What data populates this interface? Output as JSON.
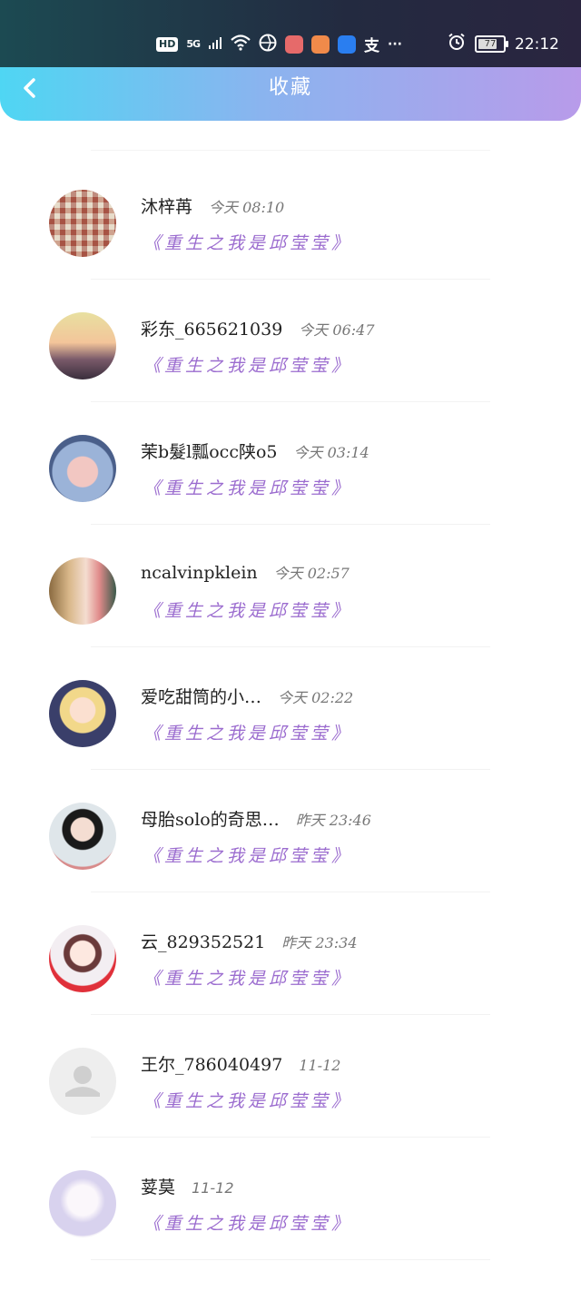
{
  "status_bar": {
    "network_hd": "HD",
    "network_type": "5G",
    "more": "···",
    "battery": "77",
    "time": "22:12",
    "app_icon_colors": [
      "#e66a6a",
      "#f08a4a",
      "#2a7ef0"
    ],
    "alipay": "支"
  },
  "header": {
    "title": "收藏",
    "back_icon": "chevron-left-icon"
  },
  "items": [
    {
      "name": "沐梓苒",
      "time": "今天 08:10",
      "book": "《重生之我是邱莹莹》",
      "avatar": "photo"
    },
    {
      "name": "彩东_665621039",
      "time": "今天 06:47",
      "book": "《重生之我是邱莹莹》",
      "avatar": "photo"
    },
    {
      "name": "茉b髮l瓢occ陕o5",
      "time": "今天 03:14",
      "book": "《重生之我是邱莹莹》",
      "avatar": "photo"
    },
    {
      "name": "ncalvinpklein",
      "time": "今天 02:57",
      "book": "《重生之我是邱莹莹》",
      "avatar": "photo"
    },
    {
      "name": "爱吃甜筒的小…",
      "time": "今天 02:22",
      "book": "《重生之我是邱莹莹》",
      "avatar": "photo"
    },
    {
      "name": "母胎solo的奇思…",
      "time": "昨天 23:46",
      "book": "《重生之我是邱莹莹》",
      "avatar": "photo"
    },
    {
      "name": "云_829352521",
      "time": "昨天 23:34",
      "book": "《重生之我是邱莹莹》",
      "avatar": "photo"
    },
    {
      "name": "王尔_786040497",
      "time": "11-12",
      "book": "《重生之我是邱莹莹》",
      "avatar": "default-user-icon"
    },
    {
      "name": "荽莫",
      "time": "11-12",
      "book": "《重生之我是邱莹莹》",
      "avatar": "photo"
    }
  ]
}
